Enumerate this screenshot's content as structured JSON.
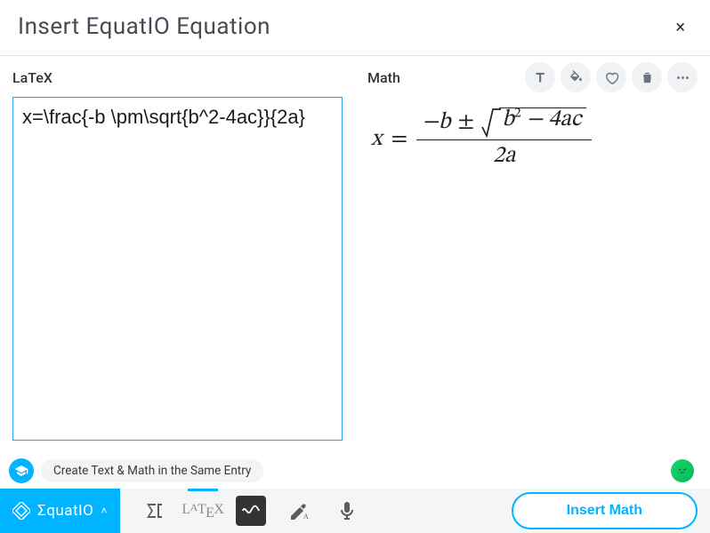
{
  "title": "Insert EquatIO Equation",
  "close": "×",
  "left": {
    "label": "LaTeX",
    "content": "x=\\frac{-b \\pm\\sqrt{b^2-4ac}}{2a}"
  },
  "right": {
    "label": "Math"
  },
  "eq": {
    "lhs": "x",
    "eqsign": "=",
    "num_minus_b": "−b",
    "pm": "±",
    "radicand_b": "b",
    "radicand_exp": "2",
    "radicand_rest": " − 4ac",
    "den": "2a"
  },
  "icons": {
    "text": "text-style-icon",
    "fill": "paint-bucket-icon",
    "heart": "favorite-icon",
    "trash": "delete-icon",
    "more": "more-icon"
  },
  "tip": "Create Text & Math in the Same Entry",
  "brand": "ΣquatIO",
  "brand_caret": "˄",
  "insert_label": "Insert Math"
}
